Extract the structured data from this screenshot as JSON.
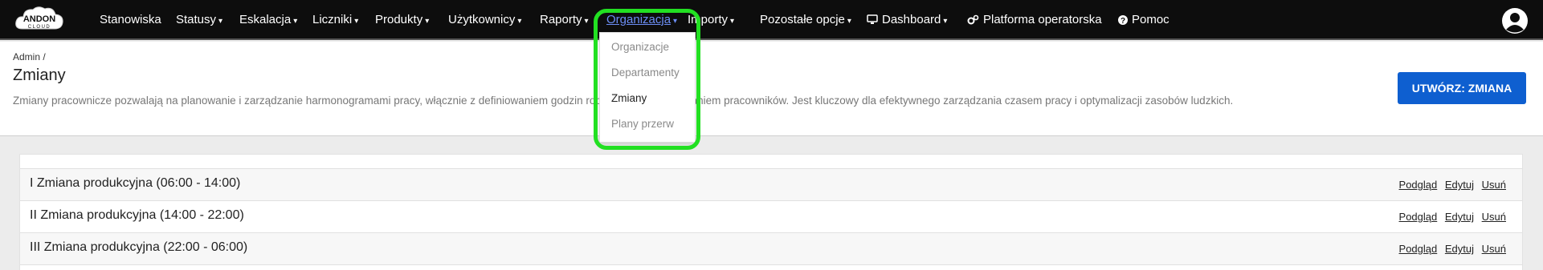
{
  "brand": {
    "logo_text": "ANDON CLOUD"
  },
  "nav": {
    "items": [
      {
        "label": "Stanowiska",
        "caret": ""
      },
      {
        "label": "Statusy",
        "caret": "▾"
      },
      {
        "label": "Eskalacja",
        "caret": "▾"
      },
      {
        "label": "Liczniki",
        "caret": "▾"
      },
      {
        "label": "Produkty",
        "caret": "▾"
      },
      {
        "label": "Użytkownicy",
        "caret": "▾"
      },
      {
        "label": "Raporty",
        "caret": "▾"
      },
      {
        "label": "Organizacja",
        "caret": "▾"
      },
      {
        "label": "Importy",
        "caret": "▾"
      },
      {
        "label": "Pozostałe opcje",
        "caret": "▾"
      },
      {
        "label": "Dashboard",
        "caret": "▾"
      },
      {
        "label": "Platforma operatorska",
        "caret": ""
      },
      {
        "label": "Pomoc",
        "caret": ""
      }
    ],
    "active_color": "#6c8ef5"
  },
  "dropdown": {
    "items": [
      {
        "label": "Organizacje"
      },
      {
        "label": "Departamenty"
      },
      {
        "label": "Zmiany"
      },
      {
        "label": "Plany przerw"
      }
    ],
    "highlight_color": "#22e022"
  },
  "header": {
    "breadcrumb": "Admin /",
    "title": "Zmiany",
    "description": "Zmiany pracownicze pozwalają na planowanie i zarządzanie harmonogramami pracy, włącznie z definiowaniem godzin roboczych i przypisywaniem pracowników. Jest kluczowy dla efektywnego zarządzania czasem pracy i optymalizacji zasobów ludzkich.",
    "create_button": "UTWÓRZ: ZMIANA",
    "button_color": "#0e5fd0"
  },
  "shifts": {
    "rows": [
      {
        "name": "I Zmiana produkcyjna (06:00 - 14:00)"
      },
      {
        "name": "II Zmiana produkcyjna (14:00 - 22:00)"
      },
      {
        "name": "III Zmiana produkcyjna (22:00 - 06:00)"
      }
    ],
    "actions": {
      "view": "Podgląd",
      "edit": "Edytuj",
      "delete": "Usuń"
    }
  }
}
